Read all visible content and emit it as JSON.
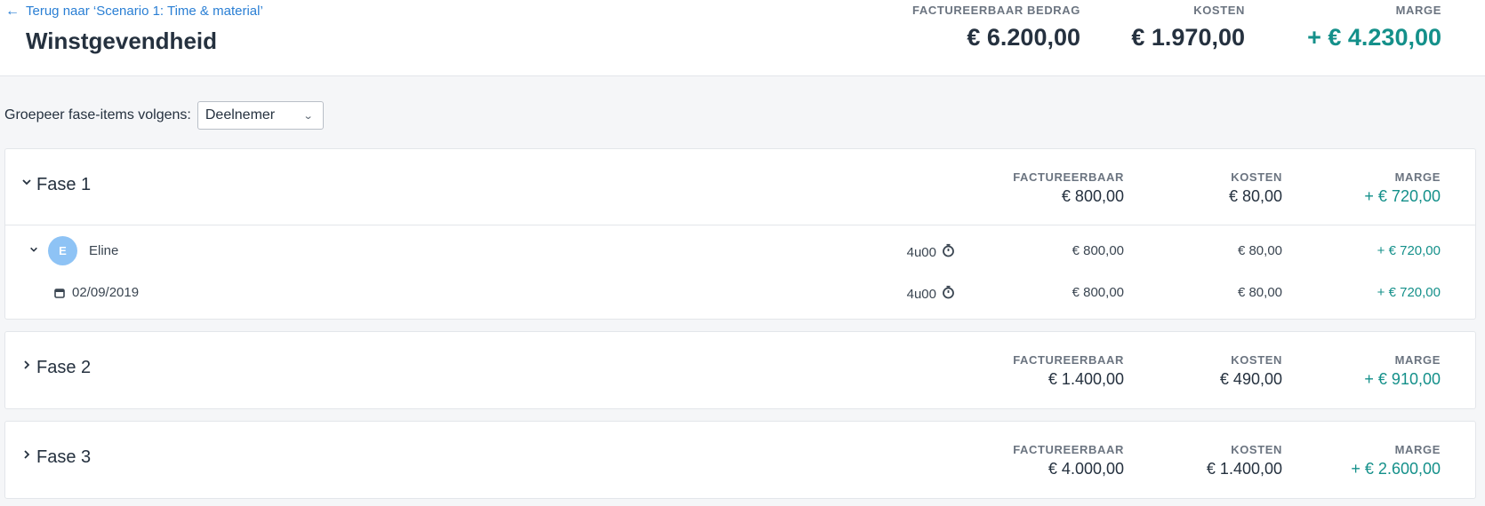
{
  "header": {
    "back_label": "Terug naar ‘Scenario 1: Time & material’",
    "title": "Winstgevendheid",
    "summary": [
      {
        "label": "FACTUREERBAAR BEDRAG",
        "value": "€ 6.200,00"
      },
      {
        "label": "KOSTEN",
        "value": "€ 1.970,00"
      },
      {
        "label": "MARGE",
        "value": "+ € 4.230,00"
      }
    ]
  },
  "grouping": {
    "label": "Groepeer fase-items volgens:",
    "selected": "Deelnemer"
  },
  "columns": {
    "billable": "FACTUREERBAAR",
    "costs": "KOSTEN",
    "margin": "MARGE"
  },
  "phases": [
    {
      "name": "Fase 1",
      "expanded": true,
      "billable": "€ 800,00",
      "costs": "€ 80,00",
      "margin": "+ € 720,00",
      "participants": [
        {
          "initial": "E",
          "name": "Eline",
          "hours": "4u00",
          "billable": "€ 800,00",
          "costs": "€ 80,00",
          "margin": "+ € 720,00",
          "entries": [
            {
              "date": "02/09/2019",
              "hours": "4u00",
              "billable": "€ 800,00",
              "costs": "€ 80,00",
              "margin": "+ € 720,00"
            }
          ]
        }
      ]
    },
    {
      "name": "Fase 2",
      "expanded": false,
      "billable": "€ 1.400,00",
      "costs": "€ 490,00",
      "margin": "+ € 910,00"
    },
    {
      "name": "Fase 3",
      "expanded": false,
      "billable": "€ 4.000,00",
      "costs": "€ 1.400,00",
      "margin": "+ € 2.600,00"
    }
  ],
  "colors": {
    "accent": "#2a7fd4",
    "positive": "#14908a",
    "avatar": "#8ec3f5"
  }
}
